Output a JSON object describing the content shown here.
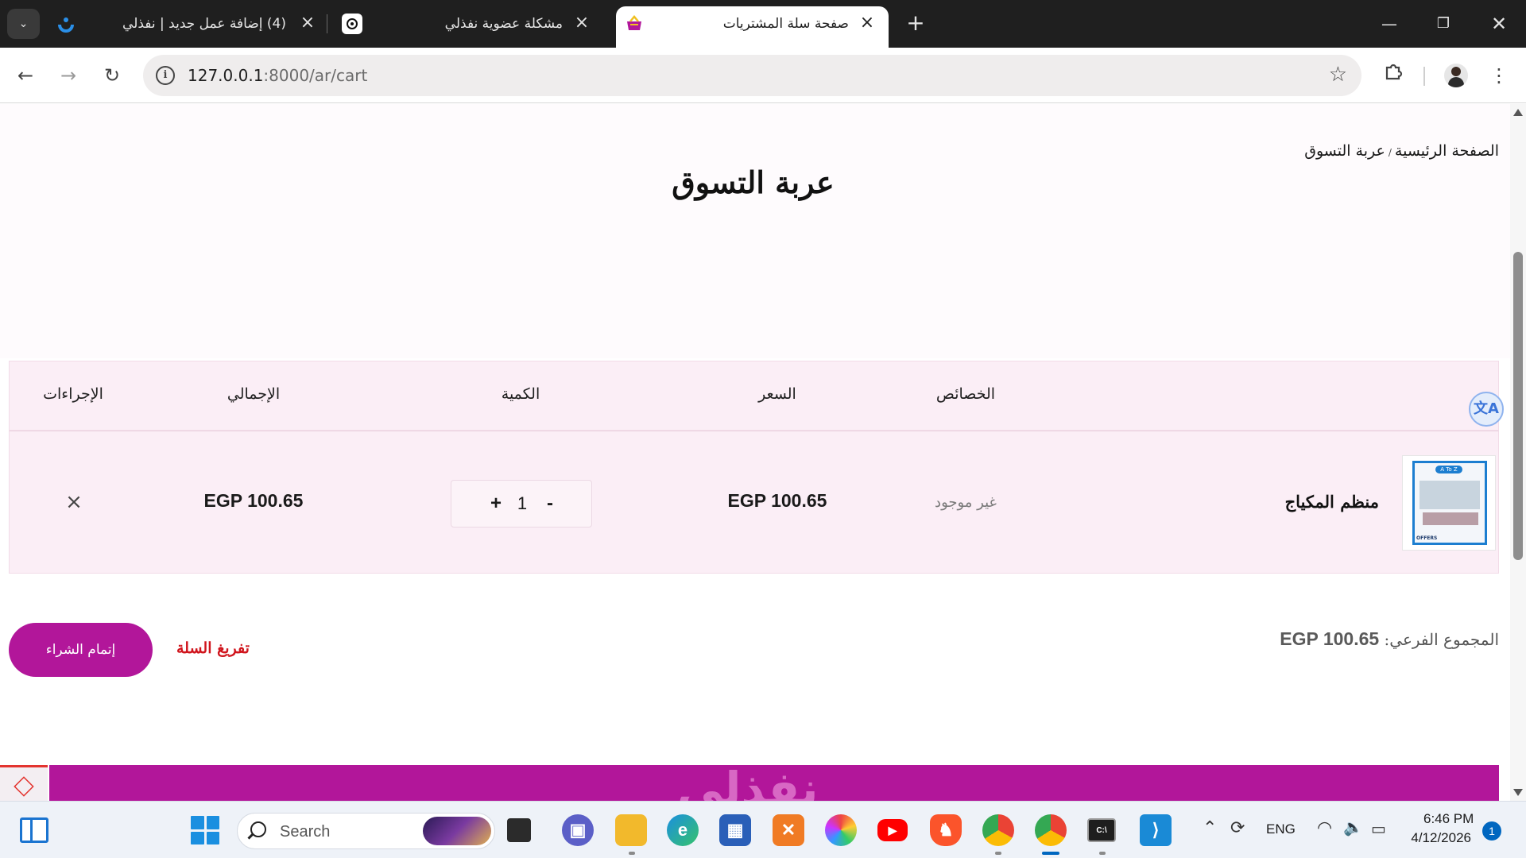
{
  "browser": {
    "tabs": [
      {
        "title": "(4) إضافة عمل جديد | نفذلي",
        "active": false
      },
      {
        "title": "مشكلة عضوية نفذلي",
        "active": false
      },
      {
        "title": "صفحة سلة المشتريات",
        "active": true
      }
    ],
    "url_host": "127.0.0.1",
    "url_path": ":8000/ar/cart"
  },
  "page": {
    "breadcrumb": {
      "home": "الصفحة الرئيسية",
      "separator": "/",
      "current": "عربة التسوق"
    },
    "title": "عربة التسوق",
    "table": {
      "headers": {
        "properties": "الخصائص",
        "price": "السعر",
        "quantity": "الكمية",
        "total": "الإجمالي",
        "actions": "الإجراءات"
      },
      "rows": [
        {
          "name": "منظم المكياج",
          "attributes": "غير موجود",
          "price": "EGP 100.65",
          "quantity": "1",
          "total": "EGP 100.65",
          "image_text": {
            "tag": "A To Z",
            "badge": "OFFERS"
          }
        }
      ]
    },
    "subtotal_label": "المجموع الفرعي:",
    "subtotal_value": "EGP 100.65",
    "clear_cart": "تفريغ السلة",
    "checkout": "إتمام الشراء",
    "footer_brand": "نفذلي"
  },
  "taskbar": {
    "search_placeholder": "Search",
    "language": "ENG",
    "time": "6:46 PM",
    "date": "4/12/2026",
    "notifications": "1"
  },
  "colors": {
    "brand": "#b2169a",
    "danger": "#d0141c",
    "row_bg": "#fbeef6"
  }
}
